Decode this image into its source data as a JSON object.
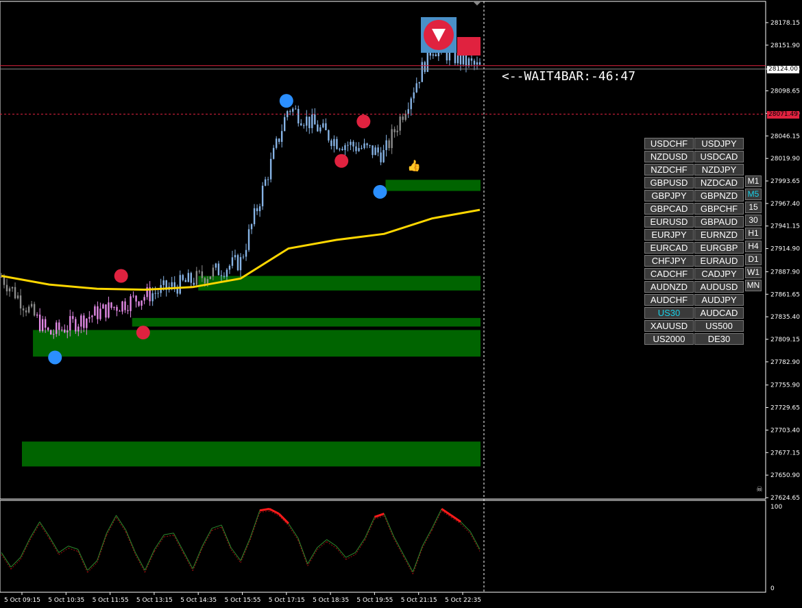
{
  "indicator": {
    "timer_label": "<--WAIT4BAR:-46:47"
  },
  "colors": {
    "background": "#000000",
    "bull_candle": "#87b4e6",
    "bear_candle_early": "#e38ae6",
    "neutral_candle": "#8c8c8c",
    "moving_average": "#ffd700",
    "zone": "#006400",
    "signal_buy": "#2b8fff",
    "signal_sell": "#e0223f",
    "osc_green": "#00e600",
    "osc_red": "#ff1a1a",
    "active_button_text": "#19d1e8"
  },
  "price_axis": {
    "labels": [
      "28178.15",
      "28151.90",
      "28124.00",
      "28098.65",
      "28072.40",
      "28046.15",
      "28019.90",
      "27993.65",
      "27967.40",
      "27941.15",
      "27914.90",
      "27887.90",
      "27861.65",
      "27835.40",
      "27809.15",
      "27782.90",
      "27755.90",
      "27729.65",
      "27703.40",
      "27677.15",
      "27650.90",
      "27624.65"
    ],
    "current_price": "28124.00",
    "red_level": "28071.49"
  },
  "oscillator_axis": {
    "top": "100",
    "bottom": "0"
  },
  "time_axis": {
    "labels": [
      "5 Oct 09:15",
      "5 Oct 10:35",
      "5 Oct 11:55",
      "5 Oct 13:15",
      "5 Oct 14:35",
      "5 Oct 15:55",
      "5 Oct 17:15",
      "5 Oct 18:35",
      "5 Oct 19:55",
      "5 Oct 21:15",
      "5 Oct 22:35"
    ]
  },
  "symbol_panel": {
    "rows": [
      [
        "USDCHF",
        "USDJPY"
      ],
      [
        "NZDUSD",
        "USDCAD"
      ],
      [
        "NZDCHF",
        "NZDJPY"
      ],
      [
        "GBPUSD",
        "NZDCAD"
      ],
      [
        "GBPJPY",
        "GBPNZD"
      ],
      [
        "GBPCAD",
        "GBPCHF"
      ],
      [
        "EURUSD",
        "GBPAUD"
      ],
      [
        "EURJPY",
        "EURNZD"
      ],
      [
        "EURCAD",
        "EURGBP"
      ],
      [
        "CHFJPY",
        "EURAUD"
      ],
      [
        "CADCHF",
        "CADJPY"
      ],
      [
        "AUDNZD",
        "AUDUSD"
      ],
      [
        "AUDCHF",
        "AUDJPY"
      ],
      [
        "US30",
        "AUDCAD"
      ],
      [
        "XAUUSD",
        "US500"
      ],
      [
        "US2000",
        "DE30"
      ]
    ],
    "active_symbol": "US30"
  },
  "timeframe_panel": {
    "items": [
      "M1",
      "M5",
      "15",
      "30",
      "H1",
      "H4",
      "D1",
      "W1",
      "MN"
    ],
    "active": "M5"
  },
  "chart_data": {
    "type": "line",
    "title": "",
    "xlabel": "",
    "ylabel": "",
    "ylim": [
      27624.65,
      28178.15
    ],
    "x": [
      "5 Oct 09:15",
      "5 Oct 10:35",
      "5 Oct 11:55",
      "5 Oct 13:15",
      "5 Oct 14:35",
      "5 Oct 15:55",
      "5 Oct 17:15",
      "5 Oct 18:35",
      "5 Oct 19:55",
      "5 Oct 21:15",
      "5 Oct 22:35"
    ],
    "series": [
      {
        "values": [
          27882,
          27815,
          27840,
          27860,
          27878,
          27900,
          28080,
          28040,
          28025,
          28150,
          28125
        ]
      }
    ],
    "moving_average": {
      "values": [
        27883,
        27873,
        27868,
        27867,
        27870,
        27880,
        27915,
        27925,
        27932,
        27950,
        27960
      ]
    },
    "zones": [
      {
        "top": 27995,
        "bottom": 27982,
        "x_start": "5 Oct 20:15"
      },
      {
        "top": 27883,
        "bottom": 27866,
        "x_start": "5 Oct 14:35"
      },
      {
        "top": 27834,
        "bottom": 27824,
        "x_start": "5 Oct 12:35"
      },
      {
        "top": 27820,
        "bottom": 27789,
        "x_start": "5 Oct 09:35"
      },
      {
        "top": 27690,
        "bottom": 27661,
        "x_start": "5 Oct 09:15"
      }
    ],
    "signals": [
      {
        "type": "buy",
        "time": "5 Oct 10:15",
        "price": 27788
      },
      {
        "type": "sell",
        "time": "5 Oct 12:15",
        "price": 27883
      },
      {
        "type": "sell",
        "time": "5 Oct 12:55",
        "price": 27817
      },
      {
        "type": "buy",
        "time": "5 Oct 17:15",
        "price": 28087
      },
      {
        "type": "sell",
        "time": "5 Oct 18:55",
        "price": 28017
      },
      {
        "type": "sell",
        "time": "5 Oct 19:35",
        "price": 28063
      },
      {
        "type": "buy",
        "time": "5 Oct 20:05",
        "price": 27981
      }
    ],
    "oscillator": {
      "ylim": [
        0,
        100
      ],
      "values": [
        44,
        26,
        38,
        62,
        82,
        64,
        44,
        52,
        48,
        22,
        34,
        68,
        90,
        72,
        44,
        22,
        48,
        66,
        68,
        46,
        24,
        52,
        74,
        78,
        50,
        34,
        62,
        96,
        98,
        92,
        80,
        62,
        30,
        50,
        60,
        52,
        38,
        44,
        62,
        88,
        92,
        64,
        42,
        20,
        52,
        74,
        98,
        90,
        82,
        70,
        48
      ]
    }
  }
}
